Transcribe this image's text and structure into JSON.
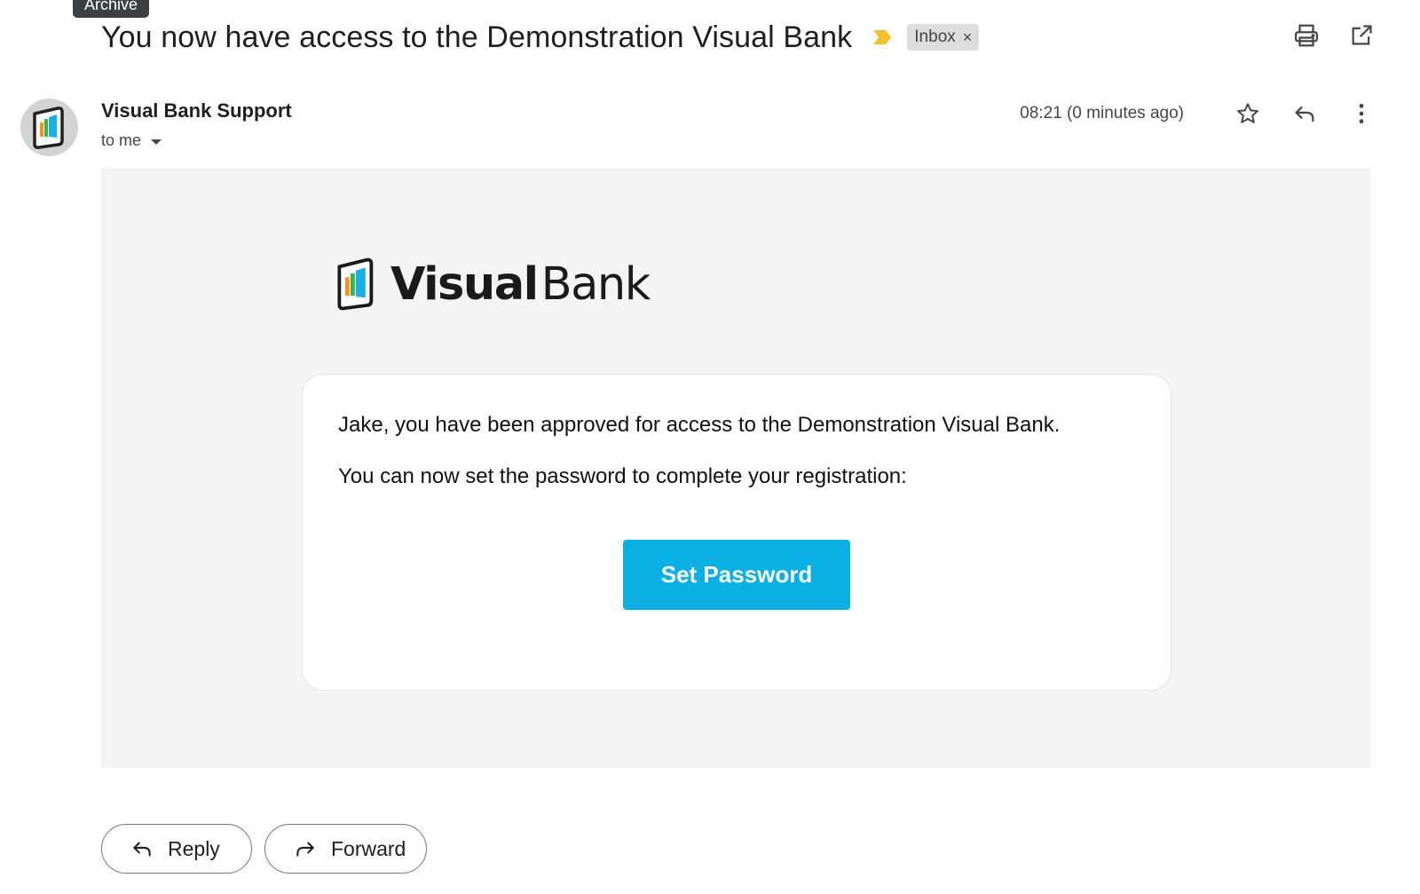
{
  "tooltip": "Archive",
  "subject": "You now have access to the Demonstration Visual Bank",
  "label_chip": {
    "text": "Inbox",
    "remove": "×"
  },
  "sender": {
    "name": "Visual Bank Support",
    "to": "to me"
  },
  "time": "08:21 (0 minutes ago)",
  "brand": {
    "bold": "Visual",
    "regular": "Bank"
  },
  "body": {
    "line1": "Jake, you have been approved for access to the Demonstration Visual Bank.",
    "line2": "You can now set the password to complete your registration:",
    "button": "Set Password"
  },
  "actions": {
    "reply": "Reply",
    "forward": "Forward"
  },
  "colors": {
    "button": "#0ab0e4",
    "importance": "#f2c12e",
    "body_bg": "#f3f4f5"
  },
  "icons": [
    "print-icon",
    "open-in-new-window-icon",
    "star-icon",
    "reply-icon",
    "more-vert-icon",
    "importance-marker-icon",
    "caret-down-icon",
    "forward-icon"
  ]
}
